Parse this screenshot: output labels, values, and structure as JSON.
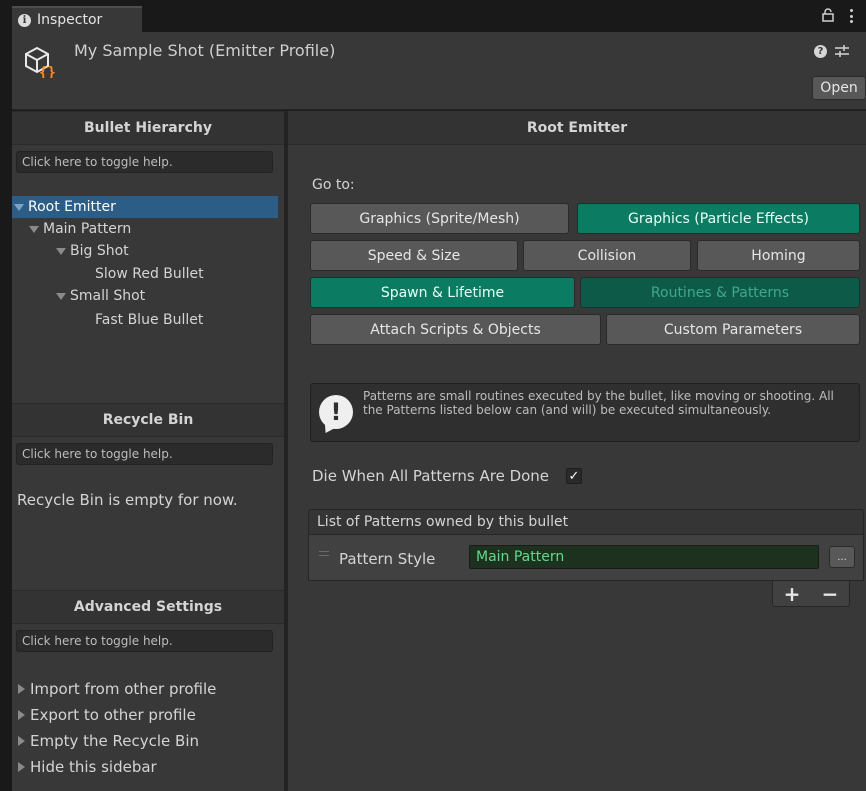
{
  "tab": {
    "label": "Inspector"
  },
  "header": {
    "title": "My Sample Shot (Emitter Profile)",
    "open_label": "Open",
    "help_glyph": "?"
  },
  "sidebar": {
    "hierarchy_title": "Bullet Hierarchy",
    "help_toggle": "Click here to toggle help.",
    "tree": [
      {
        "label": "Root Emitter",
        "expanded": true,
        "selected": true
      },
      {
        "label": "Main Pattern",
        "expanded": true
      },
      {
        "label": "Big Shot",
        "expanded": true
      },
      {
        "label": "Slow Red Bullet"
      },
      {
        "label": "Small Shot",
        "expanded": true
      },
      {
        "label": "Fast Blue Bullet"
      }
    ],
    "recycle_title": "Recycle Bin",
    "recycle_empty": "Recycle Bin is empty for now.",
    "advanced_title": "Advanced Settings",
    "advanced_items": [
      "Import from other profile",
      "Export to other profile",
      "Empty the Recycle Bin",
      "Hide this sidebar"
    ]
  },
  "main": {
    "title": "Root Emitter",
    "goto_label": "Go to:",
    "buttons": [
      {
        "label": "Graphics (Sprite/Mesh)",
        "state": "normal"
      },
      {
        "label": "Graphics (Particle Effects)",
        "state": "active"
      },
      {
        "label": "Speed & Size",
        "state": "normal"
      },
      {
        "label": "Collision",
        "state": "normal"
      },
      {
        "label": "Homing",
        "state": "normal"
      },
      {
        "label": "Spawn & Lifetime",
        "state": "active"
      },
      {
        "label": "Routines & Patterns",
        "state": "selected-dim"
      },
      {
        "label": "Attach Scripts & Objects",
        "state": "normal"
      },
      {
        "label": "Custom Parameters",
        "state": "normal"
      }
    ],
    "info_text": "Patterns are small routines executed by the bullet, like moving or shooting. All the Patterns listed below can (and will) be executed simultaneously.",
    "die_label": "Die When All Patterns Are Done",
    "die_checked": true,
    "check_glyph": "✓",
    "list_header": "List of Patterns owned by this bullet",
    "pattern_label": "Pattern Style",
    "pattern_value": "Main Pattern",
    "more_label": "...",
    "plus_label": "+",
    "minus_label": "−"
  },
  "colors": {
    "accent_teal": "#0b7c62",
    "selection_blue": "#2c5d87",
    "field_green_text": "#63d98a",
    "panel_bg": "#383838"
  }
}
